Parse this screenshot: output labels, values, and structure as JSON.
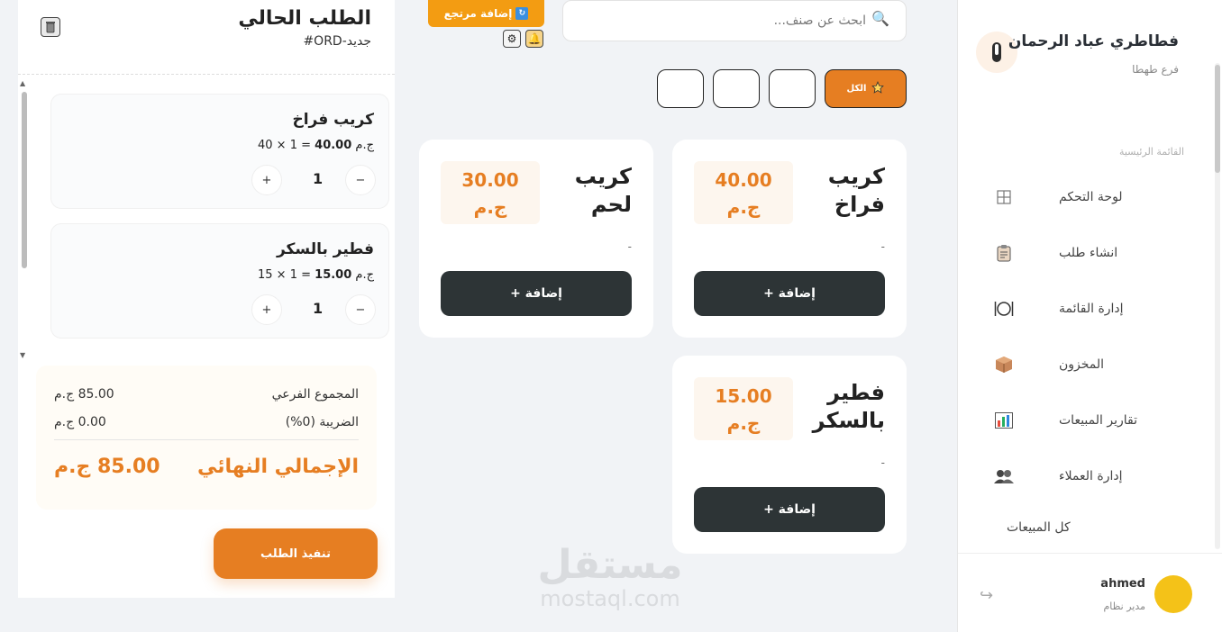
{
  "sidebar": {
    "brand_name": "فطاطري عباد الرحمان",
    "branch": "فرع طهطا",
    "section_title": "القائمة الرئيسية",
    "items": [
      {
        "label": "لوحة التحكم",
        "icon": "grid-icon"
      },
      {
        "label": "انشاء طلب",
        "icon": "clipboard-icon"
      },
      {
        "label": "إدارة القائمة",
        "icon": "plate-icon"
      },
      {
        "label": "المخزون",
        "icon": "box-icon"
      },
      {
        "label": "تقارير المبيعات",
        "icon": "chart-icon"
      },
      {
        "label": "إدارة العملاء",
        "icon": "users-icon"
      }
    ],
    "all_sales": "كل المبيعات",
    "user": {
      "name": "ahmed",
      "role": "مدير نظام"
    }
  },
  "order": {
    "title": "الطلب الحالي",
    "number": "#ORD-جديد",
    "items": [
      {
        "name": "كريب فراخ",
        "unit": "40",
        "qty": "1",
        "total": "40.00",
        "currency": "ج.م"
      },
      {
        "name": "فطير بالسكر",
        "unit": "15",
        "qty": "1",
        "total": "15.00",
        "currency": "ج.م"
      }
    ],
    "subtotal_label": "المجموع الفرعي",
    "subtotal_value": "85.00 ج.م",
    "tax_label": "الضريبة (0%)",
    "tax_value": "0.00 ج.م",
    "total_label": "الإجمالي النهائي",
    "total_value": "85.00 ج.م",
    "checkout_label": "تنفيذ الطلب"
  },
  "search": {
    "placeholder": "ابحث عن صنف..."
  },
  "toolbar": {
    "return_label": "إضافة مرتجع"
  },
  "categories": {
    "active_label": "الكل"
  },
  "products": [
    {
      "name": "كريب فراخ",
      "price": "40.00",
      "currency": "ج.م",
      "desc": "-",
      "add_label": "إضافة +"
    },
    {
      "name": "كريب لحم",
      "price": "30.00",
      "currency": "ج.م",
      "desc": "-",
      "add_label": "إضافة +"
    },
    {
      "name": "فطير بالسكر",
      "price": "15.00",
      "currency": "ج.م",
      "desc": "-",
      "add_label": "إضافة +"
    }
  ],
  "watermark": {
    "ar": "مستقل",
    "en": "mostaql.com"
  },
  "colors": {
    "accent": "#e67e22",
    "dark_button": "#2d3436",
    "avatar": "#f4c218"
  }
}
